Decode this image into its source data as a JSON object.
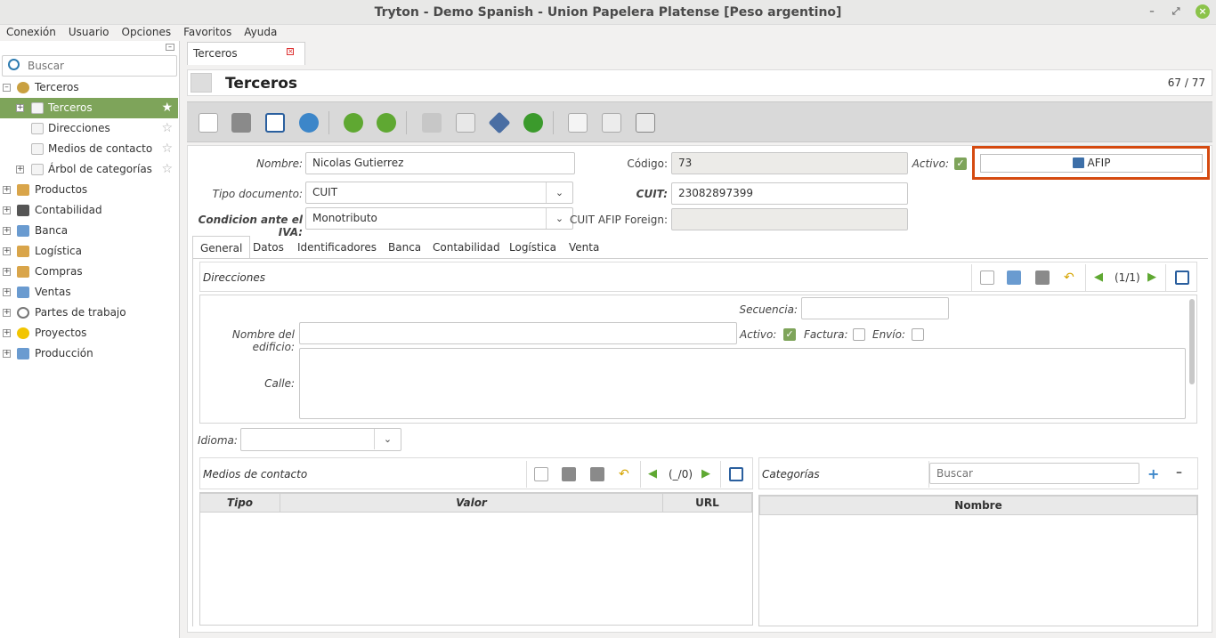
{
  "window": {
    "title": "Tryton - Demo Spanish - Union Papelera Platense [Peso argentino]"
  },
  "menu": [
    "Conexión",
    "Usuario",
    "Opciones",
    "Favoritos",
    "Ayuda"
  ],
  "sidebar": {
    "search_placeholder": "Buscar",
    "items": [
      {
        "label": "Terceros"
      },
      {
        "label": "Terceros"
      },
      {
        "label": "Direcciones"
      },
      {
        "label": "Medios de contacto"
      },
      {
        "label": "Árbol de categorías"
      },
      {
        "label": "Productos"
      },
      {
        "label": "Contabilidad"
      },
      {
        "label": "Banca"
      },
      {
        "label": "Logística"
      },
      {
        "label": "Compras"
      },
      {
        "label": "Ventas"
      },
      {
        "label": "Partes de trabajo"
      },
      {
        "label": "Proyectos"
      },
      {
        "label": "Producción"
      }
    ]
  },
  "doc_tab": {
    "label": "Terceros"
  },
  "header": {
    "title": "Terceros",
    "count": "67 / 77"
  },
  "form": {
    "nombre_label": "Nombre:",
    "nombre_value": "Nicolas Gutierrez",
    "codigo_label": "Código:",
    "codigo_value": "73",
    "activo_label": "Activo:",
    "afip_button": "AFIP",
    "tipo_doc_label": "Tipo documento:",
    "tipo_doc_value": "CUIT",
    "cuit_label": "CUIT:",
    "cuit_value": "23082897399",
    "iva_label": "Condicion ante el IVA:",
    "iva_value": "Monotributo",
    "cuit_foreign_label": "CUIT AFIP Foreign:",
    "cuit_foreign_value": ""
  },
  "tabs": [
    "General",
    "Datos",
    "Identificadores",
    "Banca",
    "Contabilidad",
    "Logística",
    "Venta"
  ],
  "direcciones": {
    "title": "Direcciones",
    "pager": "(1/1)",
    "secuencia_label": "Secuencia:",
    "edificio_label": "Nombre del edificio:",
    "activo_label": "Activo:",
    "factura_label": "Factura:",
    "envio_label": "Envío:",
    "calle_label": "Calle:"
  },
  "idioma": {
    "label": "Idioma:",
    "value": ""
  },
  "contacto": {
    "title": "Medios de contacto",
    "pager": "(_/0)",
    "columns": [
      "Tipo",
      "Valor",
      "URL"
    ]
  },
  "categorias": {
    "title": "Categorías",
    "search_placeholder": "Buscar",
    "columns": [
      "Nombre"
    ]
  }
}
